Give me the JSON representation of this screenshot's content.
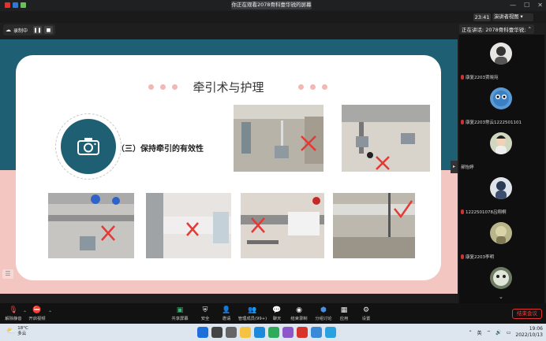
{
  "topbar": {
    "share_banner": "你正在观看2078骨科壹华锐的屏幕"
  },
  "secondbar": {
    "clock": "23:41",
    "view_mode": "演讲者视图"
  },
  "recording": {
    "label": "录制中"
  },
  "presenter": {
    "label": "正在讲话: 2078骨科壹华锐;"
  },
  "slide": {
    "title": "牵引术与护理",
    "subtitle": "（三）保持牵引的有效性"
  },
  "participants": [
    {
      "name": "康复2203贾晓宛"
    },
    {
      "name": "康复2203常云1222501101"
    },
    {
      "name": "郝怡婷"
    },
    {
      "name": "1222501078吕翔桐"
    },
    {
      "name": "康复2203李明"
    }
  ],
  "toolbar": {
    "left": [
      {
        "label": "解除静音",
        "icon": "mic-muted-icon"
      },
      {
        "label": "开启视频",
        "icon": "video-off-icon"
      }
    ],
    "center": [
      {
        "label": "共享屏幕",
        "icon": "share-screen-icon"
      },
      {
        "label": "安全",
        "icon": "shield-icon"
      },
      {
        "label": "邀请",
        "icon": "invite-icon"
      },
      {
        "label": "管理成员(99+)",
        "icon": "members-icon"
      },
      {
        "label": "聊天",
        "icon": "chat-icon"
      },
      {
        "label": "结束录制",
        "icon": "record-icon"
      },
      {
        "label": "分组讨论",
        "icon": "breakout-icon"
      },
      {
        "label": "应用",
        "icon": "apps-icon"
      },
      {
        "label": "设置",
        "icon": "gear-icon"
      }
    ],
    "end_label": "结束会议"
  },
  "taskbar": {
    "temp": "18°C",
    "weather": "多云",
    "ime": "英",
    "time": "19:06",
    "date": "2022/10/13"
  }
}
